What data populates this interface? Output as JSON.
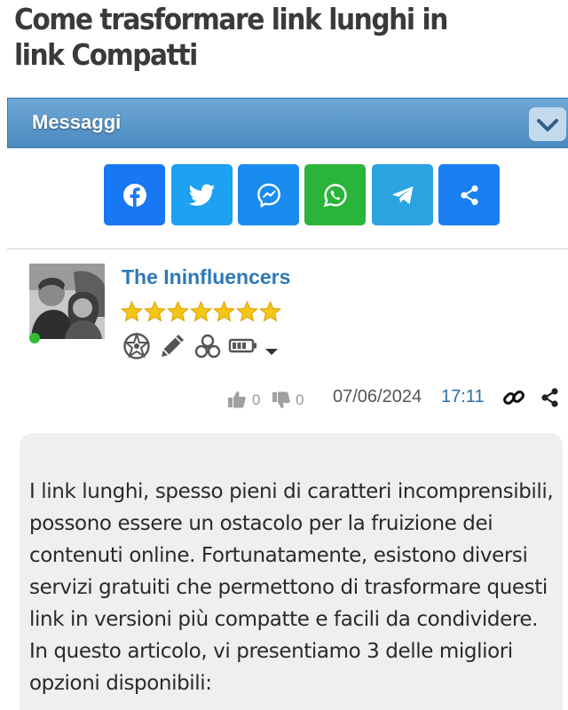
{
  "page": {
    "title": "Come trasformare link lunghi in link Compatti"
  },
  "section": {
    "title": "Messaggi"
  },
  "share": {
    "buttons": [
      {
        "icon": "facebook-icon",
        "color": "#1877f2"
      },
      {
        "icon": "twitter-icon",
        "color": "#1da1f2"
      },
      {
        "icon": "messenger-icon",
        "color": "#1a8cf0"
      },
      {
        "icon": "whatsapp-icon",
        "color": "#2ab53a"
      },
      {
        "icon": "telegram-icon",
        "color": "#2aa3e0"
      },
      {
        "icon": "share-icon",
        "color": "#1a7ff0"
      }
    ]
  },
  "post": {
    "author": "The Ininfluencers",
    "rating_stars": 7,
    "likes": "0",
    "dislikes": "0",
    "date": "07/06/2024",
    "time": "17:11",
    "body": "I link lunghi, spesso pieni di caratteri incomprensibili, possono essere un ostacolo per la fruizione dei contenuti online. Fortunatamente, esistono diversi servizi gratuiti che permettono di trasformare questi link in versioni più compatte e facili da condividere. In questo articolo, vi presentiamo 3 delle migliori opzioni disponibili:"
  },
  "colors": {
    "accent": "#2e78b7",
    "star": "#f5c518",
    "online": "#2fbf2f"
  }
}
